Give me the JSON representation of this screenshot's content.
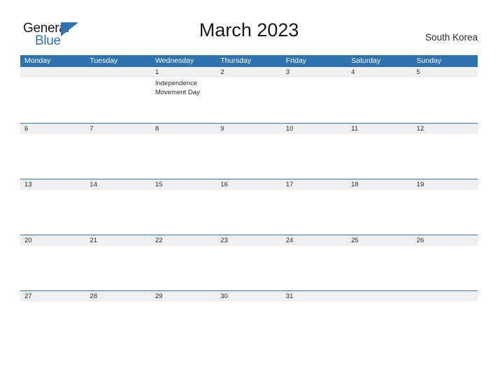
{
  "brand": {
    "name_part1": "General",
    "name_part2": "Blue",
    "accent_color": "#2e72b0"
  },
  "header": {
    "title": "March 2023",
    "region": "South Korea"
  },
  "calendar": {
    "weekdays": [
      "Monday",
      "Tuesday",
      "Wednesday",
      "Thursday",
      "Friday",
      "Saturday",
      "Sunday"
    ],
    "header_bg": "#2e72b0",
    "band_bg": "#f0f0f0",
    "weeks": [
      {
        "days": [
          {
            "num": "",
            "events": []
          },
          {
            "num": "",
            "events": []
          },
          {
            "num": "1",
            "events": [
              "Independence Movement Day"
            ]
          },
          {
            "num": "2",
            "events": []
          },
          {
            "num": "3",
            "events": []
          },
          {
            "num": "4",
            "events": []
          },
          {
            "num": "5",
            "events": []
          }
        ]
      },
      {
        "days": [
          {
            "num": "6",
            "events": []
          },
          {
            "num": "7",
            "events": []
          },
          {
            "num": "8",
            "events": []
          },
          {
            "num": "9",
            "events": []
          },
          {
            "num": "10",
            "events": []
          },
          {
            "num": "11",
            "events": []
          },
          {
            "num": "12",
            "events": []
          }
        ]
      },
      {
        "days": [
          {
            "num": "13",
            "events": []
          },
          {
            "num": "14",
            "events": []
          },
          {
            "num": "15",
            "events": []
          },
          {
            "num": "16",
            "events": []
          },
          {
            "num": "17",
            "events": []
          },
          {
            "num": "18",
            "events": []
          },
          {
            "num": "19",
            "events": []
          }
        ]
      },
      {
        "days": [
          {
            "num": "20",
            "events": []
          },
          {
            "num": "21",
            "events": []
          },
          {
            "num": "22",
            "events": []
          },
          {
            "num": "23",
            "events": []
          },
          {
            "num": "24",
            "events": []
          },
          {
            "num": "25",
            "events": []
          },
          {
            "num": "26",
            "events": []
          }
        ]
      },
      {
        "days": [
          {
            "num": "27",
            "events": []
          },
          {
            "num": "28",
            "events": []
          },
          {
            "num": "29",
            "events": []
          },
          {
            "num": "30",
            "events": []
          },
          {
            "num": "31",
            "events": []
          },
          {
            "num": "",
            "events": []
          },
          {
            "num": "",
            "events": []
          }
        ]
      }
    ]
  }
}
